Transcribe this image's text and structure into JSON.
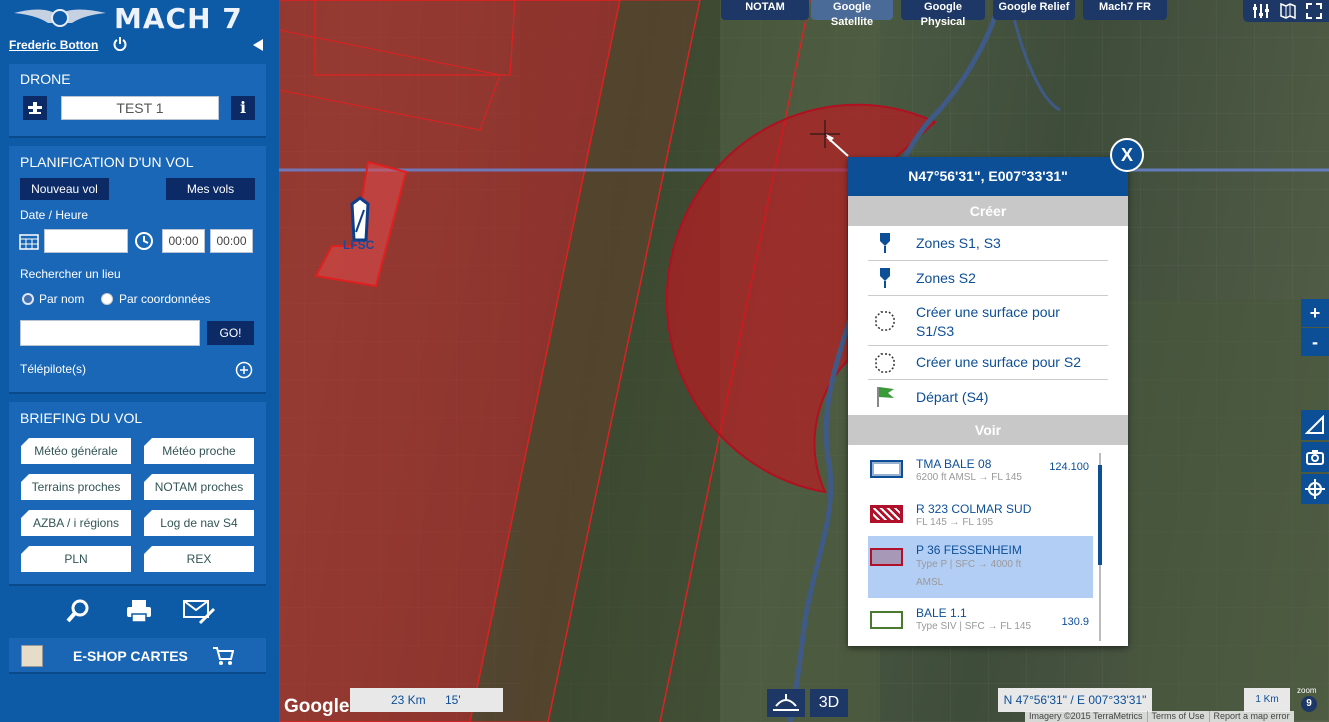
{
  "app": {
    "brand": "MACH 7",
    "user_name": "Frederic Botton"
  },
  "drone": {
    "title": "DRONE",
    "name_value": "TEST 1"
  },
  "planning": {
    "title": "PLANIFICATION D'UN VOL",
    "new_flight": "Nouveau vol",
    "my_flights": "Mes vols",
    "datetime_label": "Date / Heure",
    "date_value": "",
    "time_start": "00:00",
    "time_end": "00:00",
    "search_label": "Rechercher un lieu",
    "by_name": "Par nom",
    "by_coords": "Par coordonnées",
    "search_value": "",
    "go": "GO!",
    "telepilots": "Télépilote(s)"
  },
  "briefing": {
    "title": "BRIEFING DU VOL",
    "buttons": [
      "Météo générale",
      "Météo proche",
      "Terrains proches",
      "NOTAM proches",
      "AZBA / i régions",
      "Log de nav S4",
      "PLN",
      "REX"
    ]
  },
  "shop": {
    "label": "E-SHOP CARTES"
  },
  "map_tabs": [
    "NOTAM",
    "Google Satellite",
    "Google Physical",
    "Google Relief",
    "Mach7 FR"
  ],
  "active_tab": "Google Satellite",
  "map": {
    "airport_code": "LFSC"
  },
  "popup": {
    "coords": "N47°56'31\", E007°33'31\"",
    "create_title": "Créer",
    "create_items": [
      "Zones S1, S3",
      "Zones S2",
      "Créer une surface pour S1/S3",
      "Créer une surface pour S2",
      "Départ (S4)"
    ],
    "see_title": "Voir",
    "zones": [
      {
        "name": "TMA BALE 08",
        "sub": "6200 ft AMSL → FL 145",
        "freq": "124.100"
      },
      {
        "name": "R 323 COLMAR SUD",
        "sub": "FL 145 → FL 195",
        "freq": ""
      },
      {
        "name": "P 36 FESSENHEIM",
        "sub": "Type P | SFC → 4000 ft AMSL",
        "freq": ""
      },
      {
        "name": "BALE 1.1",
        "sub": "Type SIV | SFC → FL 145",
        "freq": "130.9"
      }
    ],
    "close": "X"
  },
  "scale": {
    "km": "23 Km",
    "min": "15'"
  },
  "cursor_coords": "N 47°56'31\" / E 007°33'31\"",
  "scale_km": "1 Km",
  "zoom": {
    "label": "zoom",
    "value": "9"
  },
  "view_3d": "3D",
  "zoom_in": "+",
  "zoom_out": "-",
  "credits": [
    "Imagery ©2015 TerraMetrics",
    "Terms of Use",
    "Report a map error"
  ],
  "google": "Google",
  "colors": {
    "sidebar": "#0d5aa7",
    "panel": "#1967b6",
    "accent": "#0d4f97",
    "zone_red": "#d0202a"
  }
}
